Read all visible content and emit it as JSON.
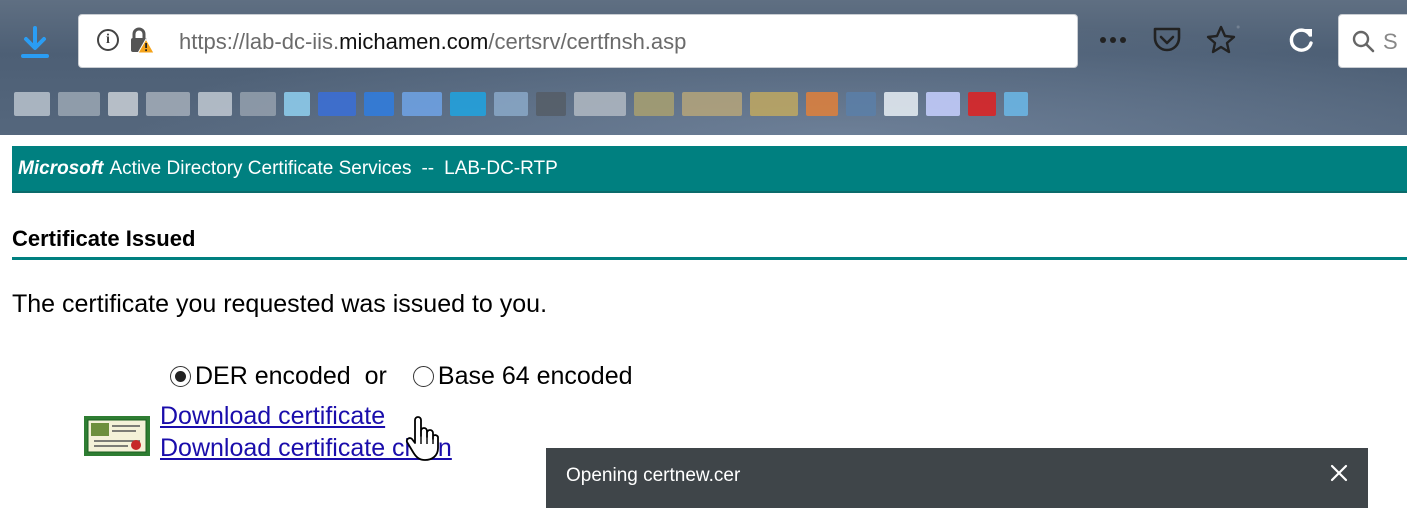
{
  "browser": {
    "url_prefix": "https://lab-dc-iis.",
    "url_host": "michamen.com",
    "url_path": "/certsrv/certfnsh.asp",
    "search_placeholder": "S",
    "icons": [
      "download-icon",
      "info-icon",
      "insecure-lock-icon",
      "more-actions-icon",
      "pocket-icon",
      "bookmark-star-icon",
      "reload-icon",
      "search-icon"
    ]
  },
  "banner": {
    "brand": "Microsoft",
    "service": "Active Directory Certificate Services",
    "separator": "--",
    "ca_name": "LAB-DC-RTP"
  },
  "page": {
    "title": "Certificate Issued",
    "message": "The certificate you requested was issued to you.",
    "encoding": {
      "der_label": "DER encoded",
      "or_label": "or",
      "base64_label": "Base 64 encoded",
      "selected": "der"
    },
    "links": {
      "download_certificate": "Download certificate",
      "download_chain": "Download certificate chain"
    }
  },
  "dialog": {
    "title": "Opening certnew.cer",
    "close_label": "✕"
  },
  "colors": {
    "banner_bg": "#008080",
    "link": "#1a0dab",
    "dialog_bg": "#3f4549",
    "download_arrow": "#2a9df4"
  }
}
